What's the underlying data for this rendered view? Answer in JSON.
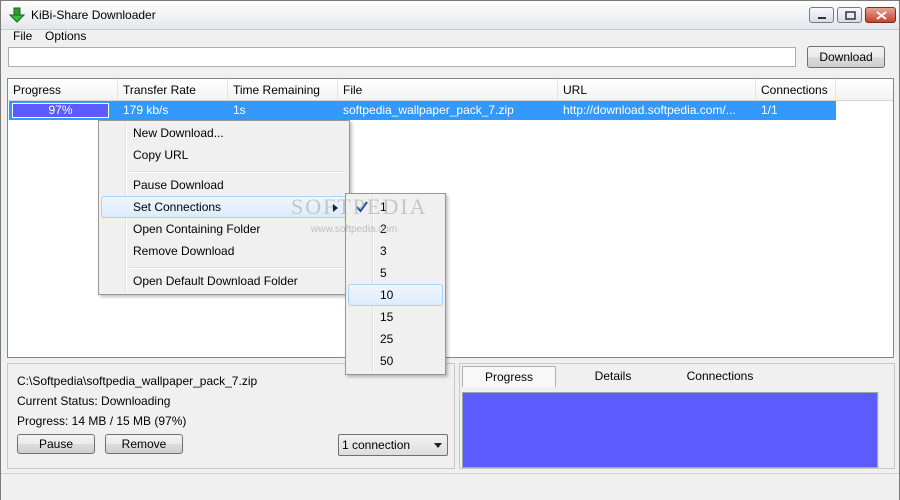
{
  "window": {
    "title": "KiBi-Share Downloader"
  },
  "menu": {
    "file": "File",
    "options": "Options"
  },
  "toolbar": {
    "url_value": "",
    "download_label": "Download"
  },
  "columns": [
    "Progress",
    "Transfer Rate",
    "Time Remaining",
    "File",
    "URL",
    "Connections"
  ],
  "download": {
    "progress_text": "97%",
    "progress_fraction": 0.97,
    "rate": "179 kb/s",
    "time_remaining": "1s",
    "file": "softpedia_wallpaper_pack_7.zip",
    "url": "http://download.softpedia.com/...",
    "connections": "1/1"
  },
  "context_menu": {
    "new_download": "New Download...",
    "copy_url": "Copy URL",
    "pause_download": "Pause Download",
    "set_connections": "Set Connections",
    "open_containing_folder": "Open Containing Folder",
    "remove_download": "Remove Download",
    "open_default_folder": "Open Default Download Folder"
  },
  "connections_submenu": {
    "options": [
      "1",
      "2",
      "3",
      "5",
      "10",
      "15",
      "25",
      "50"
    ],
    "checked": "1",
    "highlighted": "10"
  },
  "watermark": {
    "brand": "SOFTPEDIA",
    "url": "www.softpedia.com"
  },
  "details": {
    "path": "C:\\Softpedia\\softpedia_wallpaper_pack_7.zip",
    "status": "Current Status: Downloading",
    "progress": "Progress: 14 MB / 15 MB (97%)",
    "pause_label": "Pause",
    "remove_label": "Remove",
    "connection_select": "1 connection"
  },
  "tabs": {
    "progress": "Progress",
    "details": "Details",
    "connections": "Connections",
    "active": "Progress"
  },
  "colors": {
    "selection": "#3399ff",
    "progress_fill": "#5b5bff",
    "window_bg": "#f0f0f0"
  }
}
